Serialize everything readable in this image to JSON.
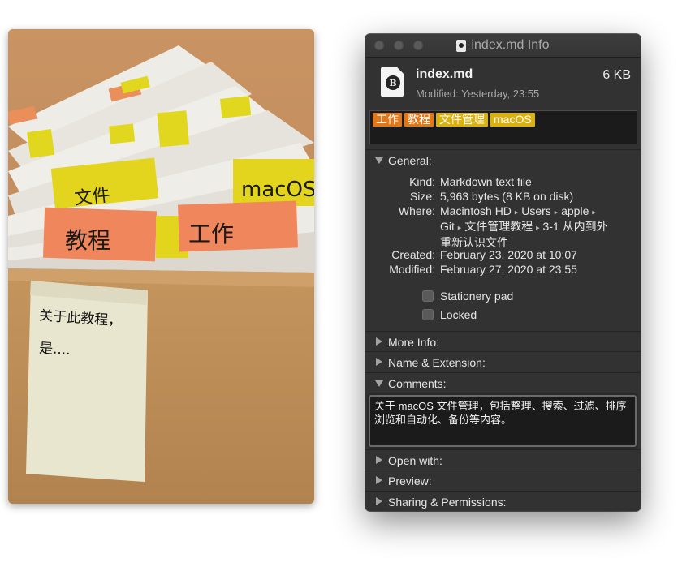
{
  "photo": {
    "notes": {
      "wenjian": "文件",
      "macos": "macOS",
      "jiaocheng": "教程",
      "gongzuo": "工作",
      "handwriting_line1": "关于此教程，",
      "handwriting_line2": "是...."
    }
  },
  "window": {
    "title": "index.md Info",
    "file_name": "index.md",
    "file_size": "6 KB",
    "modified_header": "Modified: Yesterday, 23:55",
    "tags": [
      {
        "label": "工作",
        "color": "#e0781a"
      },
      {
        "label": "教程",
        "color": "#e0781a"
      },
      {
        "label": "文件管理",
        "color": "#d9b20f"
      },
      {
        "label": "macOS",
        "color": "#d9b20f"
      }
    ],
    "general": {
      "title": "General:",
      "kind_key": "Kind:",
      "kind_value": "Markdown text file",
      "size_key": "Size:",
      "size_value": "5,963 bytes (8 KB on disk)",
      "where_key": "Where:",
      "where_line1": [
        "Macintosh HD",
        "Users",
        "apple"
      ],
      "where_line2": [
        "Git",
        "文件管理教程",
        "3-1 从内到外"
      ],
      "where_line3": "重新认识文件",
      "created_key": "Created:",
      "created_value": "February 23, 2020 at 10:07",
      "modified_key": "Modified:",
      "modified_value": "February 27, 2020 at 23:55",
      "stationery_label": "Stationery pad",
      "locked_label": "Locked"
    },
    "sections": {
      "more_info": "More Info:",
      "name_ext": "Name & Extension:",
      "comments": "Comments:",
      "open_with": "Open with:",
      "preview": "Preview:",
      "sharing": "Sharing & Permissions:"
    },
    "comments_text": "关于 macOS 文件管理，包括整理、搜索、过滤、排序浏览和自动化、备份等内容。"
  }
}
